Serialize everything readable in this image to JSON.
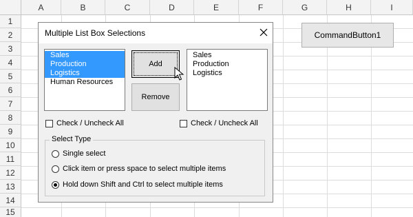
{
  "sheet": {
    "columns": [
      "A",
      "B",
      "C",
      "D",
      "E",
      "F",
      "G",
      "H",
      "I"
    ],
    "rows": [
      "1",
      "2",
      "3",
      "4",
      "5",
      "6",
      "7",
      "8",
      "9",
      "10",
      "11",
      "12",
      "13",
      "14",
      "15"
    ]
  },
  "command_button": {
    "label": "CommandButton1"
  },
  "userform": {
    "title": "Multiple List Box Selections",
    "left_list": {
      "items": [
        "Sales",
        "Production",
        "Logistics",
        "Human Resources"
      ],
      "selected": [
        true,
        true,
        true,
        false
      ]
    },
    "add_label": "Add",
    "remove_label": "Remove",
    "right_list": {
      "items": [
        "Sales",
        "Production",
        "Logistics"
      ]
    },
    "check_left_label": "Check / Uncheck All",
    "check_right_label": "Check / Uncheck All",
    "select_type": {
      "legend": "Select Type",
      "options": [
        {
          "label": "Single select",
          "checked": false
        },
        {
          "label": "Click item or press space to select multiple items",
          "checked": false
        },
        {
          "label": "Hold down Shift and Ctrl to select multiple items",
          "checked": true
        }
      ]
    }
  }
}
